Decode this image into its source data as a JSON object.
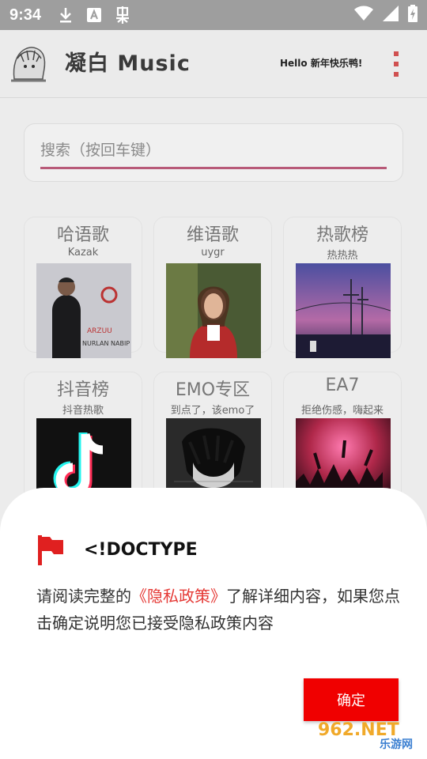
{
  "status_bar": {
    "time": "9:34",
    "icons": [
      "download-icon",
      "keyboard-a-icon",
      "bug-icon"
    ],
    "right_icons": [
      "wifi-icon",
      "signal-icon",
      "battery-icon"
    ]
  },
  "app": {
    "title": "凝白 Music",
    "greeting": "Hello 新年快乐鸭!",
    "search": {
      "placeholder": "搜索（按回车键）",
      "value": ""
    },
    "cards": [
      {
        "title": "哈语歌",
        "subtitle": "Kazak"
      },
      {
        "title": "维语歌",
        "subtitle": "uygr"
      },
      {
        "title": "热歌榜",
        "subtitle": "热热热"
      },
      {
        "title": "抖音榜",
        "subtitle": "抖音热歌"
      },
      {
        "title": "EMO专区",
        "subtitle": "到点了，该emo了"
      },
      {
        "title": "EA7",
        "subtitle": "拒绝伤感，嗨起来"
      }
    ],
    "album_text": {
      "line1": "ARZUU",
      "line2": "NURLAN NABIP"
    }
  },
  "dialog": {
    "title": "<!DOCTYPE",
    "body_before": "请阅读完整的",
    "body_link": "《隐私政策》",
    "body_after": "了解详细内容，如果您点击确定说明您已接受隐私政策内容",
    "confirm_label": "确定"
  },
  "watermark": {
    "brand": "962.NET",
    "sub": "乐游网"
  },
  "colors": {
    "accent": "#f00000",
    "link": "#e53935",
    "search_underline": "#b85a78",
    "status_bar": "#9e9e9e"
  }
}
